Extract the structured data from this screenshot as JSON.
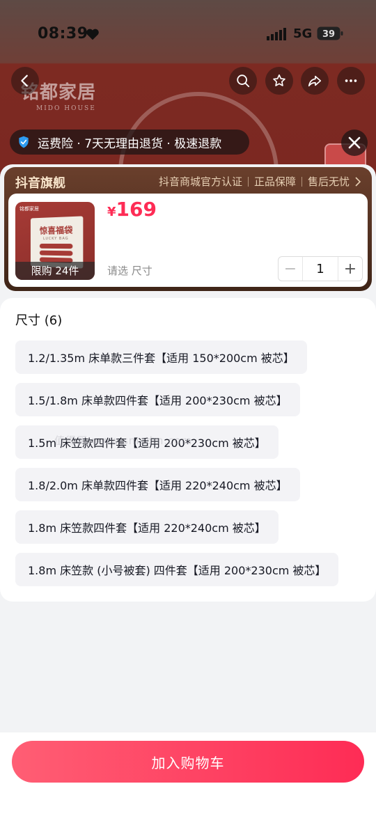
{
  "status_bar": {
    "time": "08:39",
    "network": "5G",
    "battery": "39"
  },
  "background": {
    "brand_cn": "铭都家居",
    "brand_en": "MIDO HOUSE",
    "services": "运费险 · 7天无理由退货 · 极速退款"
  },
  "store": {
    "name": "抖音旗舰",
    "badges": [
      "抖音商城官方认证",
      "正品保障",
      "售后无忧"
    ]
  },
  "product": {
    "image_logo": "铭都家居",
    "image_title": "惊喜福袋",
    "image_subtitle": "LUCKY BAG",
    "limit_label": "限购 24件",
    "price_symbol": "¥",
    "price": "169",
    "select_hint": "请选 尺寸",
    "quantity": "1",
    "minus": "−",
    "plus": "+"
  },
  "options": {
    "title": "尺寸 (6)",
    "items": [
      "1.2/1.35m 床单款三件套【适用 150*200cm 被芯】",
      "1.5/1.8m 床单款四件套【适用 200*230cm 被芯】",
      "1.5m 床笠款四件套【适用 200*230cm 被芯】",
      "1.8/2.0m 床单款四件套【适用 220*240cm 被芯】",
      "1.8m 床笠款四件套【适用 220*240cm 被芯】",
      "1.8m 床笠款 (小号被套) 四件套【适用 200*230cm 被芯】"
    ]
  },
  "watermark": "值得买 www.smzdm.com",
  "cta": {
    "label": "加入购物车"
  },
  "colors": {
    "accent": "#fe2c55",
    "store_bg": "#5a3424",
    "option_bg": "#f3f3f6"
  }
}
